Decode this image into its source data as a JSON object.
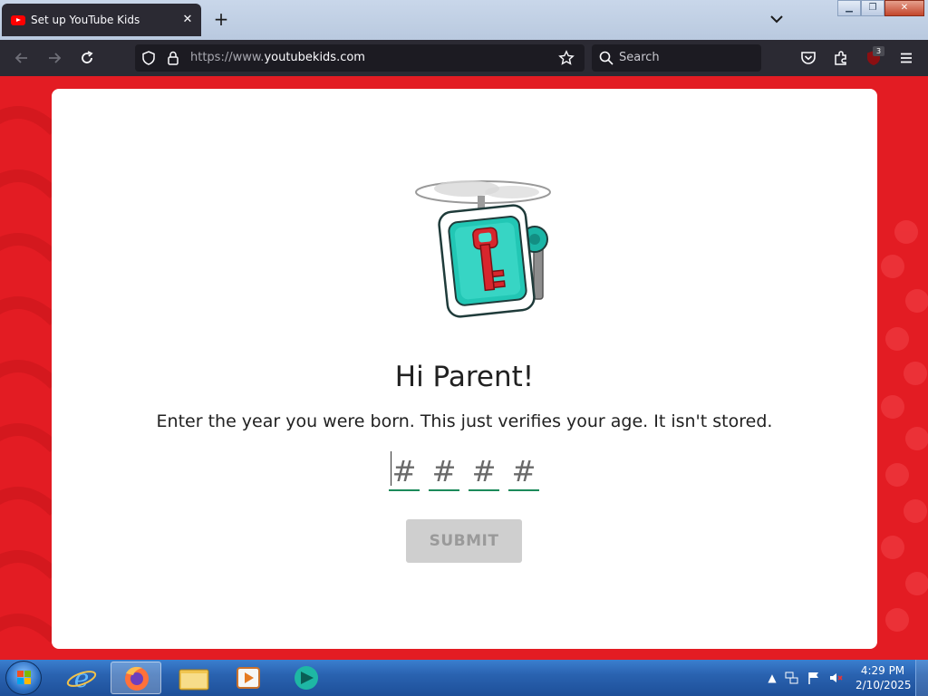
{
  "browser": {
    "tab_title": "Set up YouTube Kids",
    "tab_close_glyph": "✕",
    "new_tab_glyph": "+",
    "url_scheme": "https://www.",
    "url_host": "youtubekids.com",
    "search_placeholder": "Search",
    "extension_badge_count": "3",
    "window_buttons": {
      "minimize": "▁",
      "restore": "❐",
      "close": "✕"
    },
    "icons": [
      "back-arrow-icon",
      "forward-arrow-icon",
      "reload-icon",
      "shield-icon",
      "lock-icon",
      "star-icon",
      "search-icon",
      "pocket-icon",
      "extensions-icon",
      "ublock-icon",
      "menu-icon"
    ]
  },
  "page": {
    "heading": "Hi Parent!",
    "instructions": "Enter the year you were born. This just verifies your age. It isn't stored.",
    "digit_placeholders": [
      "#",
      "#",
      "#",
      "#"
    ],
    "submit_label": "SUBMIT",
    "colors": {
      "background": "#e31c23",
      "card": "#ffffff",
      "input_underline": "#1b8a5a",
      "submit_disabled": "#cfcfcf"
    }
  },
  "taskbar": {
    "time": "4:29 PM",
    "date": "2/10/2025",
    "pinned": [
      "internet-explorer-icon",
      "firefox-icon",
      "file-explorer-icon",
      "media-player-icon",
      "app-icon"
    ],
    "tray": [
      "show-hidden-icons-icon",
      "network-icon",
      "action-center-flag-icon",
      "volume-muted-icon"
    ]
  }
}
